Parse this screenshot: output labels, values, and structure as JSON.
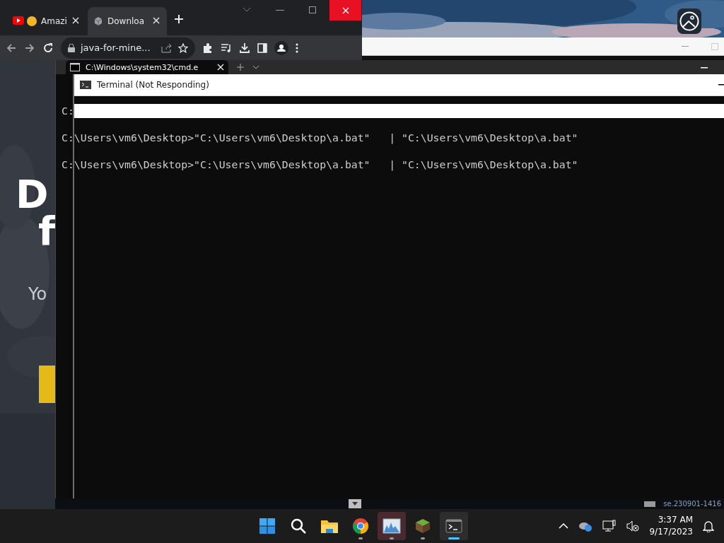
{
  "browser": {
    "tabs": [
      {
        "title": "Amazi",
        "kind": "youtube",
        "selected": false
      },
      {
        "title": "Downloa",
        "kind": "box",
        "selected": true
      }
    ],
    "address": "java-for-mine...",
    "page": {
      "heading_1": "D",
      "heading_2": "f",
      "subtitle": "Yo"
    }
  },
  "console": {
    "tab_title": "C:\\Windows\\system32\\cmd.e",
    "lines": [
      "C:",
      "C:\\Users\\vm6\\Desktop>\"C:\\Users\\vm6\\Desktop\\a.bat\"   | \"C:\\Users\\vm6\\Desktop\\a.bat\"",
      "C:\\Users\\vm6\\Desktop>\"C:\\Users\\vm6\\Desktop\\a.bat\"   | \"C:\\Users\\vm6\\Desktop\\a.bat\""
    ]
  },
  "ghost_window": {
    "title": "Terminal (Not Responding)"
  },
  "desktop": {
    "build_text": "se.230901-1416"
  },
  "taskbar": {
    "apps": [
      {
        "kind": "start",
        "running": false,
        "highlighted": false,
        "selected": false
      },
      {
        "kind": "search",
        "running": false,
        "highlighted": false,
        "selected": false
      },
      {
        "kind": "explorer",
        "running": false,
        "highlighted": false,
        "selected": false
      },
      {
        "kind": "chrome",
        "running": true,
        "highlighted": false,
        "selected": false
      },
      {
        "kind": "monitor",
        "running": true,
        "highlighted": true,
        "selected": false
      },
      {
        "kind": "minecraft",
        "running": true,
        "highlighted": false,
        "selected": false
      },
      {
        "kind": "terminal",
        "running": true,
        "highlighted": false,
        "selected": true
      }
    ],
    "time": "3:37 AM",
    "date": "9/17/2023"
  }
}
